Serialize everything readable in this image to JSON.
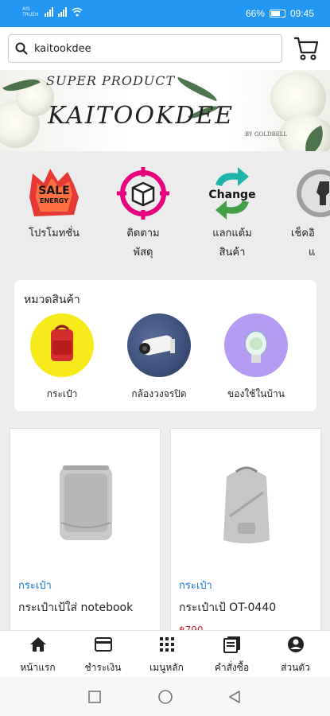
{
  "status_bar": {
    "carrier": "AIS TRUEH",
    "battery": "66%",
    "time": "09:45"
  },
  "search": {
    "value": "kaitookdee"
  },
  "banner": {
    "super_product": "SUPER PRODUCT",
    "title": "KAITOOKDEE",
    "by": "BY GOLDBELL"
  },
  "quick_menu": [
    {
      "label_line1": "โปรโมทชั่น",
      "label_line2": "",
      "icon": "sale-energy-icon",
      "badge_line1": "SALE",
      "badge_line2": "ENERGY"
    },
    {
      "label_line1": "ติดตาม",
      "label_line2": "พัสดุ",
      "icon": "track-parcel-icon"
    },
    {
      "label_line1": "แลกแต้ม",
      "label_line2": "สินค้า",
      "icon": "exchange-points-icon",
      "badge_line1": "Change"
    },
    {
      "label_line1": "เช็คอิ",
      "label_line2": "แ",
      "icon": "check-in-icon"
    }
  ],
  "categories": {
    "title": "หมวดสินค้า",
    "items": [
      {
        "label": "กระเป๋า",
        "color": "#f7ea1b"
      },
      {
        "label": "กล้องวงจรปิด",
        "color": "#3d4f7a"
      },
      {
        "label": "ของใช้ในบ้าน",
        "color": "#b59cf2"
      }
    ]
  },
  "products": [
    {
      "category": "กระเป๋า",
      "name": "กระเป๋าเป้ใส่ notebook",
      "price": ""
    },
    {
      "category": "กระเป๋า",
      "name": "กระเป๋าเป้ OT-0440",
      "price": "฿790"
    }
  ],
  "bottom_nav": [
    {
      "label": "หน้าแรก",
      "icon": "home-icon"
    },
    {
      "label": "ชำระเงิน",
      "icon": "credit-card-icon"
    },
    {
      "label": "เมนูหลัก",
      "icon": "grid-menu-icon"
    },
    {
      "label": "คำสั่งซื้อ",
      "icon": "orders-icon"
    },
    {
      "label": "ส่วนตัว",
      "icon": "account-icon"
    }
  ],
  "colors": {
    "status_bar": "#2196f3",
    "category_text": "#1976d2",
    "price": "#c62828"
  }
}
